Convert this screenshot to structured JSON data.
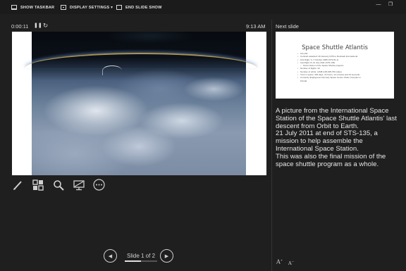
{
  "toolbar": {
    "show_taskbar": "SHOW TASKBAR",
    "display_settings": "DISPLAY SETTINGS ▾",
    "end_slide_show": "END SLIDE SHOW"
  },
  "window": {
    "minimize": "—",
    "restore": "❐"
  },
  "presenter": {
    "timer": "0:00:11",
    "clock": "9:13 AM",
    "pause_glyph": "❚❚",
    "restart_glyph": "↻"
  },
  "navigation": {
    "slide_label": "Slide 1 of 2",
    "prev_glyph": "◀",
    "next_glyph": "▶",
    "progress_fraction": 0.5
  },
  "next_slide": {
    "heading": "Next slide",
    "title": "Space Shuttle Atlantis",
    "bullets": [
      {
        "text": "OV-104",
        "level": 1
      },
      {
        "text": "Contract awarded: 29 January 1979 to Rockwell International",
        "level": 1
      },
      {
        "text": "First flight: 3–7 October 1985 (STS-51-J)",
        "level": 1
      },
      {
        "text": "Last flight: 8–21 July 2011 (STS-135)",
        "level": 1
      },
      {
        "text": "Final mission of the Space Shuttle program",
        "level": 2
      },
      {
        "text": "Number of flights: 33",
        "level": 1
      },
      {
        "text": "Number of orbits: 4,848  (125,935,769 miles)",
        "level": 1
      },
      {
        "text": "Time in space: 306 days, 14 hours, 12 minutes and 43 seconds",
        "level": 1
      },
      {
        "text": "Currently displayed at Kennedy Space Center Visitor Complex in",
        "level": 1
      },
      {
        "text": "Florida",
        "level": 0
      }
    ]
  },
  "notes": {
    "line1": "A picture from the International Space Station of the Space Shuttle Atlantis' last descent from Orbit to Earth.",
    "line2": "21 July 2011 at end of STS-135, a mission to help assemble the International Space Station.",
    "line3": "This was also the final mission of the space shuttle program as a whole."
  },
  "font_controls": {
    "increase": "A",
    "decrease": "A"
  },
  "icons": [
    "pen-icon",
    "see-all-slides-icon",
    "zoom-icon",
    "black-screen-icon",
    "more-options-icon"
  ],
  "colors": {
    "background": "#1f1f1f",
    "text": "#d0d0d0",
    "slide_bg": "#ffffff"
  }
}
